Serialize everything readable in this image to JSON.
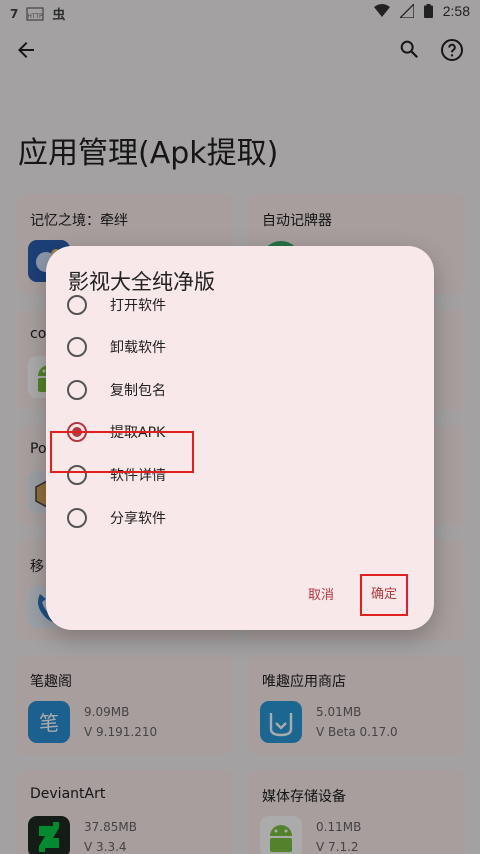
{
  "status_bar": {
    "left_icons": [
      "7",
      "HTTP",
      "bug"
    ],
    "time": "2:58"
  },
  "app_bar": {
    "back_icon": "arrow-left-icon",
    "search_icon": "search-icon",
    "help_icon": "help-circle-icon"
  },
  "page_title": "应用管理(Apk提取)",
  "cards": [
    {
      "name": "记忆之境：牵绊",
      "size": "",
      "version": "",
      "icon": "game-icon",
      "icon_color": "#2b5fb0"
    },
    {
      "name": "自动记牌器",
      "size": "",
      "version": "",
      "icon": "card-counter-icon",
      "icon_color": "#3aa86b"
    },
    {
      "name": "co",
      "size": "",
      "version": "",
      "icon": "android-icon",
      "icon_color": "#7cc142"
    },
    {
      "name": "",
      "size": "",
      "version": "",
      "icon": "",
      "icon_color": ""
    },
    {
      "name": "Po",
      "size": "",
      "version": "",
      "icon": "box-icon",
      "icon_color": "#d9a55a"
    },
    {
      "name": "",
      "size": "",
      "version": "",
      "icon": "",
      "icon_color": ""
    },
    {
      "name": "移",
      "size": "",
      "version": "",
      "icon": "phone-icon",
      "icon_color": "#2a78c9"
    },
    {
      "name": "",
      "size": "",
      "version": "",
      "icon": "",
      "icon_color": ""
    },
    {
      "name": "笔趣阁",
      "size": "9.09MB",
      "version": "V 9.191.210",
      "icon": "biquge-icon",
      "icon_color": "#2a8fd6"
    },
    {
      "name": "唯趣应用商店",
      "size": "5.01MB",
      "version": "V Beta 0.17.0",
      "icon": "store-icon",
      "icon_color": "#2a9ad9"
    },
    {
      "name": "DeviantArt",
      "size": "37.85MB",
      "version": "V 3.3.4",
      "icon": "deviantart-icon",
      "icon_color": "#1e2a24"
    },
    {
      "name": "媒体存储设备",
      "size": "0.11MB",
      "version": "V 7.1.2",
      "icon": "android-icon",
      "icon_color": "#7cc142"
    }
  ],
  "dialog": {
    "title": "影视大全纯净版",
    "options": [
      {
        "label": "打开软件",
        "selected": false
      },
      {
        "label": "卸载软件",
        "selected": false
      },
      {
        "label": "复制包名",
        "selected": false
      },
      {
        "label": "提取APK",
        "selected": true
      },
      {
        "label": "软件详情",
        "selected": false
      },
      {
        "label": "分享软件",
        "selected": false
      }
    ],
    "cancel_label": "取消",
    "ok_label": "确定"
  },
  "colors": {
    "accent": "#b23a3f",
    "card_bg": "#fbecec",
    "highlight": "#e02020"
  }
}
